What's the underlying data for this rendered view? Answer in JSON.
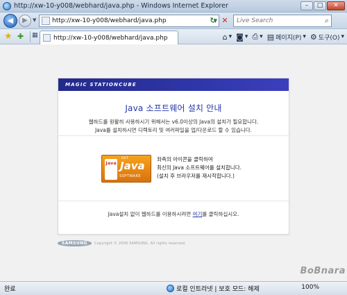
{
  "window": {
    "title": "http://xw-10-y008/webhard/java.php - Windows Internet Explorer",
    "controls": {
      "minimize": "–",
      "maximize": "□",
      "close": "✕"
    }
  },
  "address": {
    "url": "http://xw-10-y008/webhard/java.php",
    "search_placeholder": "Live Search"
  },
  "tab": {
    "label": "http://xw-10-y008/webhard/java.php"
  },
  "commands": {
    "page_label": "페이지(P)",
    "tools_label": "도구(O)"
  },
  "page": {
    "brand": "MAGIC STATIONCUBE",
    "title": "Java 소프트웨어 설치 안내",
    "desc_line1": "웹하드를 원활히 사용하시기 위해서는 v6.0이상의 Java의 설치가 필요합니다.",
    "desc_line2": "Java를 설치하시면 디렉토리 및 여러파일을 업/다운로드 할 수 있습니다.",
    "java_logo": {
      "top": "GET",
      "word": "Java",
      "sub": "SOFTWARE",
      "cup": "Java"
    },
    "java_line1": "좌측의 아이콘을 클릭하여",
    "java_line2": "최신의 Java 소프트웨어를 설치합니다.",
    "java_line3": "(설치 후 브라우저를 재시작합니다.)",
    "bottom_prefix": "Java설치 없이 웹하드를 이용하시려면 ",
    "bottom_link": "여기",
    "bottom_suffix": "를 클릭하십시오.",
    "footer_logo": "SAMSUNG",
    "copyright": "Copyright © 2006 SAMSUNG. All rights reserved."
  },
  "status": {
    "left": "완료",
    "zone": "로컬 인트라넷 | 보호 모드: 해제",
    "zoom": "100%"
  },
  "watermark": "BoBnara"
}
